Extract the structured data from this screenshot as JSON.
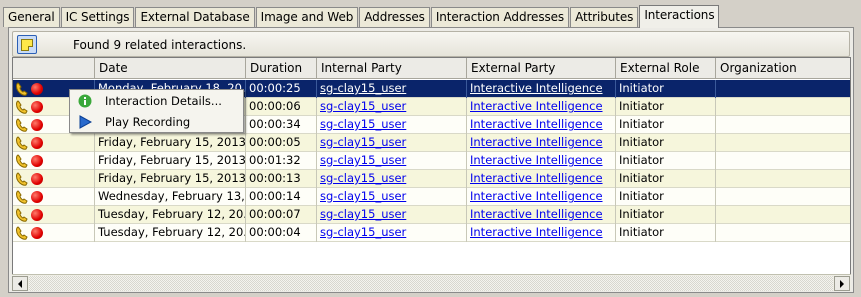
{
  "tabs": [
    "General",
    "IC Settings",
    "External Database",
    "Image and Web",
    "Addresses",
    "Interaction Addresses",
    "Attributes",
    "Interactions"
  ],
  "active_tab": "Interactions",
  "status_text": "Found 9 related interactions.",
  "columns": [
    "",
    "Date",
    "Duration",
    "Internal Party",
    "External Party",
    "External  Role",
    "Organization"
  ],
  "rows": [
    {
      "date": "Monday, February 18, 20...",
      "duration": "00:00:25",
      "internal": "sg-clay15_user",
      "external": "Interactive Intelligence",
      "role": "Initiator",
      "org": ""
    },
    {
      "date": "",
      "duration": "00:00:06",
      "internal": "sg-clay15_user",
      "external": "Interactive Intelligence",
      "role": "Initiator",
      "org": ""
    },
    {
      "date": "",
      "duration": "00:00:34",
      "internal": "sg-clay15_user",
      "external": "Interactive Intelligence",
      "role": "Initiator",
      "org": ""
    },
    {
      "date": "Friday, February 15, 2013,...",
      "duration": "00:00:05",
      "internal": "sg-clay15_user",
      "external": "Interactive Intelligence",
      "role": "Initiator",
      "org": ""
    },
    {
      "date": "Friday, February 15, 2013,...",
      "duration": "00:01:32",
      "internal": "sg-clay15_user",
      "external": "Interactive Intelligence",
      "role": "Initiator",
      "org": ""
    },
    {
      "date": "Friday, February 15, 2013,...",
      "duration": "00:00:13",
      "internal": "sg-clay15_user",
      "external": "Interactive Intelligence",
      "role": "Initiator",
      "org": ""
    },
    {
      "date": "Wednesday, February 13,...",
      "duration": "00:00:14",
      "internal": "sg-clay15_user",
      "external": "Interactive Intelligence",
      "role": "Initiator",
      "org": ""
    },
    {
      "date": "Tuesday, February 12, 20...",
      "duration": "00:00:07",
      "internal": "sg-clay15_user",
      "external": "Interactive Intelligence",
      "role": "Initiator",
      "org": ""
    },
    {
      "date": "Tuesday, February 12, 20...",
      "duration": "00:00:04",
      "internal": "sg-clay15_user",
      "external": "Interactive Intelligence",
      "role": "Initiator",
      "org": ""
    }
  ],
  "context_menu": [
    {
      "label": "Interaction Details...",
      "icon": "info-icon"
    },
    {
      "label": "Play Recording",
      "icon": "play-icon"
    }
  ],
  "colors": {
    "selection": "#0a246a",
    "row_alt": "#f6f6dc",
    "link": "#0000ee",
    "status_dot": "#e00000"
  }
}
